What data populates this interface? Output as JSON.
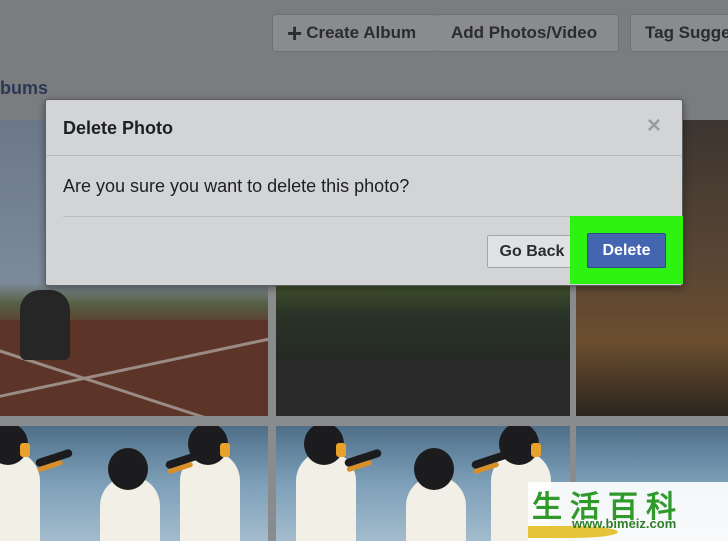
{
  "toolbar": {
    "create_album_label": "Create Album",
    "add_photos_label": "Add Photos/Video",
    "tag_suggestions_label": "Tag Sugge"
  },
  "page": {
    "albums_link": "bums"
  },
  "dialog": {
    "title": "Delete Photo",
    "close_icon": "close-icon",
    "message": "Are you sure you want to delete this photo?",
    "go_back_label": "Go Back",
    "delete_label": "Delete",
    "highlight_color": "#2ef20f",
    "delete_color": "#4466b0"
  },
  "watermark": {
    "chinese_text": "生活百科",
    "url": "www.bimeiz.com"
  }
}
